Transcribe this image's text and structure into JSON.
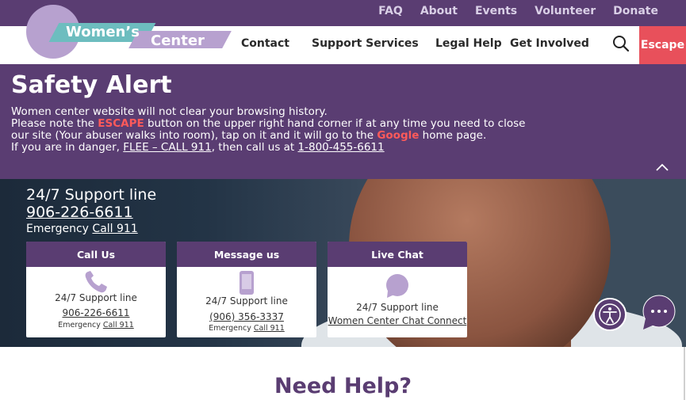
{
  "brand": {
    "line1": "Women’s",
    "line2": "Center"
  },
  "top_nav": [
    "FAQ",
    "About",
    "Events",
    "Volunteer",
    "Donate"
  ],
  "main_nav": [
    "Contact",
    "Support Services",
    "Legal Help",
    "Get Involved"
  ],
  "escape_label": "Escape",
  "alert": {
    "title": "Safety Alert",
    "line1": "Women center website will not clear your browsing history.",
    "line2a": "Please note the ",
    "escape_word": "ESCAPE",
    "line2b": " button on the upper right hand corner if at any time you need to close",
    "line3a": "our site (Your abuser walks into room), tap on it and it will go to the ",
    "google_word": "Google",
    "line3b": " home page.",
    "line4a": "If you are in danger, ",
    "flee_link": "FLEE – CALL 911",
    "line4b": ", then call us at ",
    "phone_link": "1-800-455-6611"
  },
  "hero": {
    "support_title": "24/7 Support line",
    "support_phone": "906-226-6611",
    "emergency_label": "Emergency ",
    "emergency_link": "Call 911"
  },
  "cards": {
    "call": {
      "title": "Call Us",
      "line": "24/7 Support line",
      "phone": "906-226-6611",
      "emergency_label": "Emergency ",
      "emergency_link": "Call 911"
    },
    "message": {
      "title": "Message us",
      "line": "24/7 Support line",
      "phone": "(906) 356-3337",
      "emergency_label": "Emergency ",
      "emergency_link": "Call 911"
    },
    "chat": {
      "title": "Live Chat",
      "line": "24/7 Support line",
      "link": "Women Center Chat Connect"
    }
  },
  "need_help": "Need Help?",
  "colors": {
    "purple": "#5a3d72",
    "lavender": "#b7a1cf",
    "teal": "#6dbdbf",
    "escape_red": "#e8505b"
  },
  "icons": [
    "search-icon",
    "chevron-up-icon",
    "phone-icon",
    "mobile-icon",
    "chat-bubble-icon",
    "accessibility-icon",
    "chat-icon"
  ]
}
